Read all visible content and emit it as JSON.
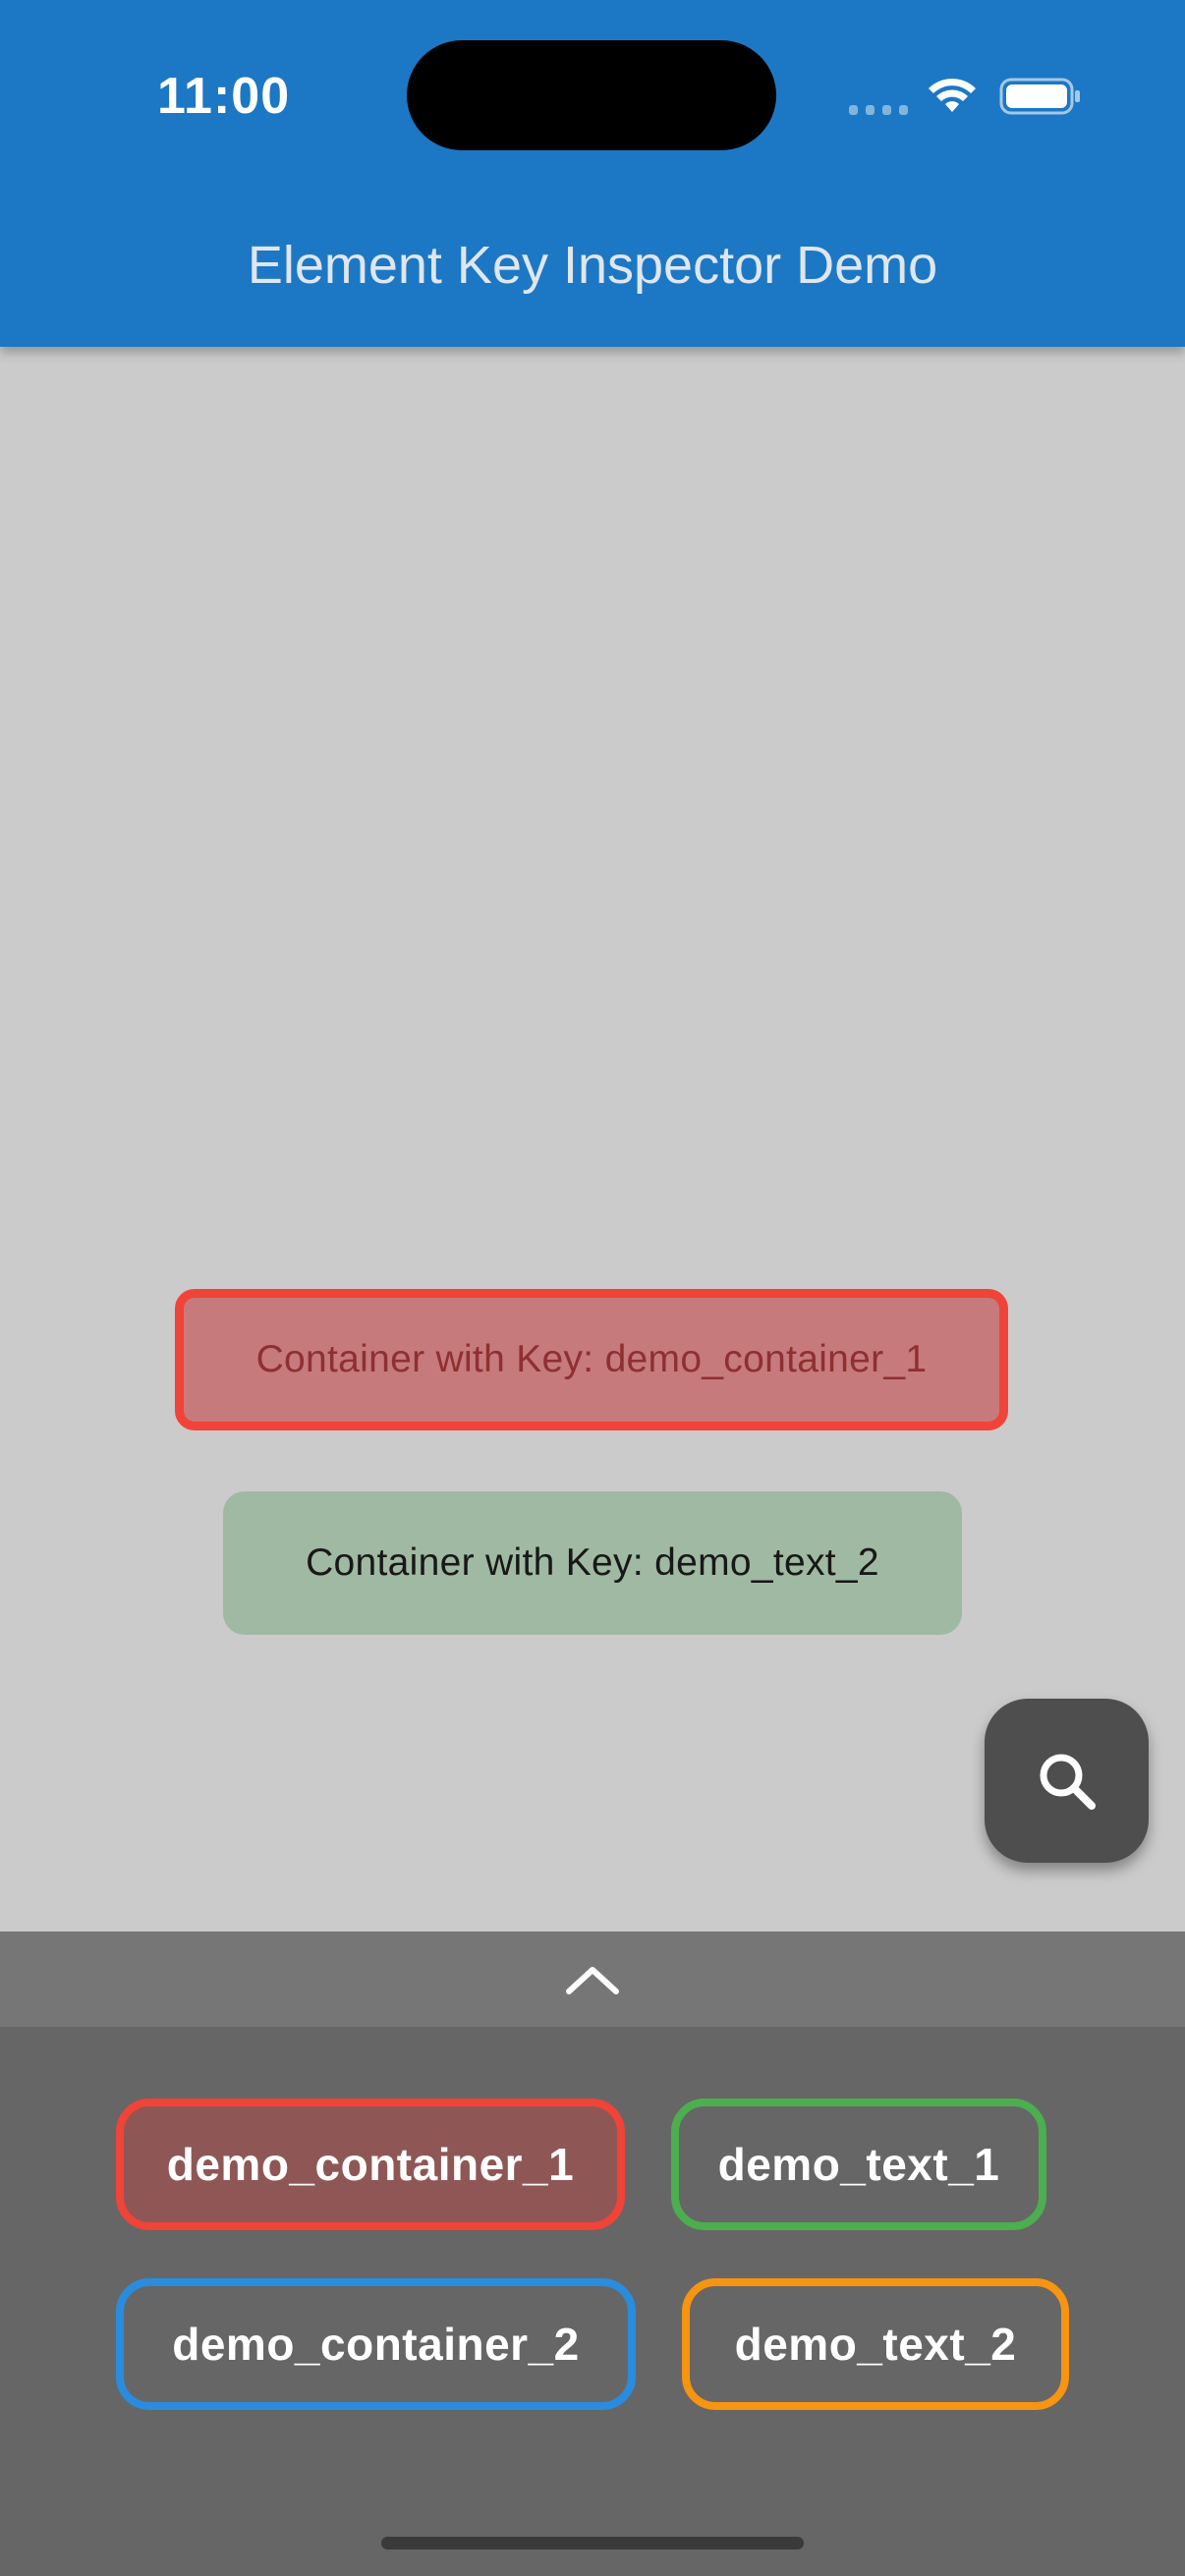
{
  "status_bar": {
    "time": "11:00"
  },
  "app_bar": {
    "title": "Element Key Inspector Demo",
    "color": "#1c78c4"
  },
  "content": {
    "container_1_text": "Container with Key: demo_container_1",
    "container_2_text": "Container with Key: demo_text_2"
  },
  "fab": {
    "icon": "search-icon"
  },
  "panel": {
    "toggle_icon": "chevron-up-icon",
    "keys": [
      {
        "label": "demo_container_1",
        "color": "#ef4437",
        "highlighted": true
      },
      {
        "label": "demo_text_1",
        "color": "#4cae4f",
        "highlighted": false
      },
      {
        "label": "demo_container_2",
        "color": "#2a8cdf",
        "highlighted": false
      },
      {
        "label": "demo_text_2",
        "color": "#f79412",
        "highlighted": false
      }
    ]
  }
}
